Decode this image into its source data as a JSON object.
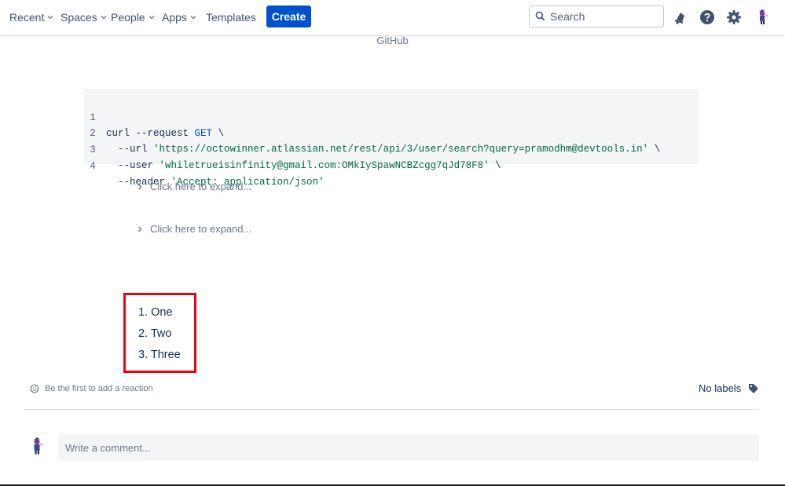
{
  "nav": {
    "items": [
      {
        "label": "Recent"
      },
      {
        "label": "Spaces"
      },
      {
        "label": "People"
      },
      {
        "label": "Apps"
      },
      {
        "label": "Templates"
      }
    ],
    "create_label": "Create",
    "search_placeholder": "Search"
  },
  "page": {
    "caption": "GitHub"
  },
  "code": {
    "line_numbers": [
      "1",
      "2",
      "3",
      "4"
    ],
    "line1_prefix": "curl --request ",
    "line1_method": "GET",
    "line1_suffix": " \\",
    "line2_prefix": "  --url ",
    "line2_string": "'https://octowinner.atlassian.net/rest/api/3/user/search?query=pramodhm@devtools.in'",
    "line2_suffix": " \\",
    "line3_prefix": "  --user ",
    "line3_string": "'whiletrueisinfinity@gmail.com:OMkIySpawNCBZcgg7qJd78F8'",
    "line3_suffix": " \\",
    "line4_prefix": "  --header ",
    "line4_string": "'Accept: application/json'"
  },
  "expanders": [
    "Click here to expand...",
    "Click here to expand..."
  ],
  "list": [
    "1. One",
    "2. Two",
    "3. Three"
  ],
  "reaction_label": "Be the first to add a reaction",
  "labels_text": "No labels",
  "comment_placeholder": "Write a comment...",
  "colors": {
    "accent": "#0052cc",
    "highlight_border": "#e30613",
    "code_bg": "#f4f5f7"
  },
  "icons": [
    "search-icon",
    "notification-icon",
    "help-icon",
    "settings-icon",
    "avatar",
    "chevron-right-icon",
    "emoji-icon",
    "label-icon"
  ]
}
